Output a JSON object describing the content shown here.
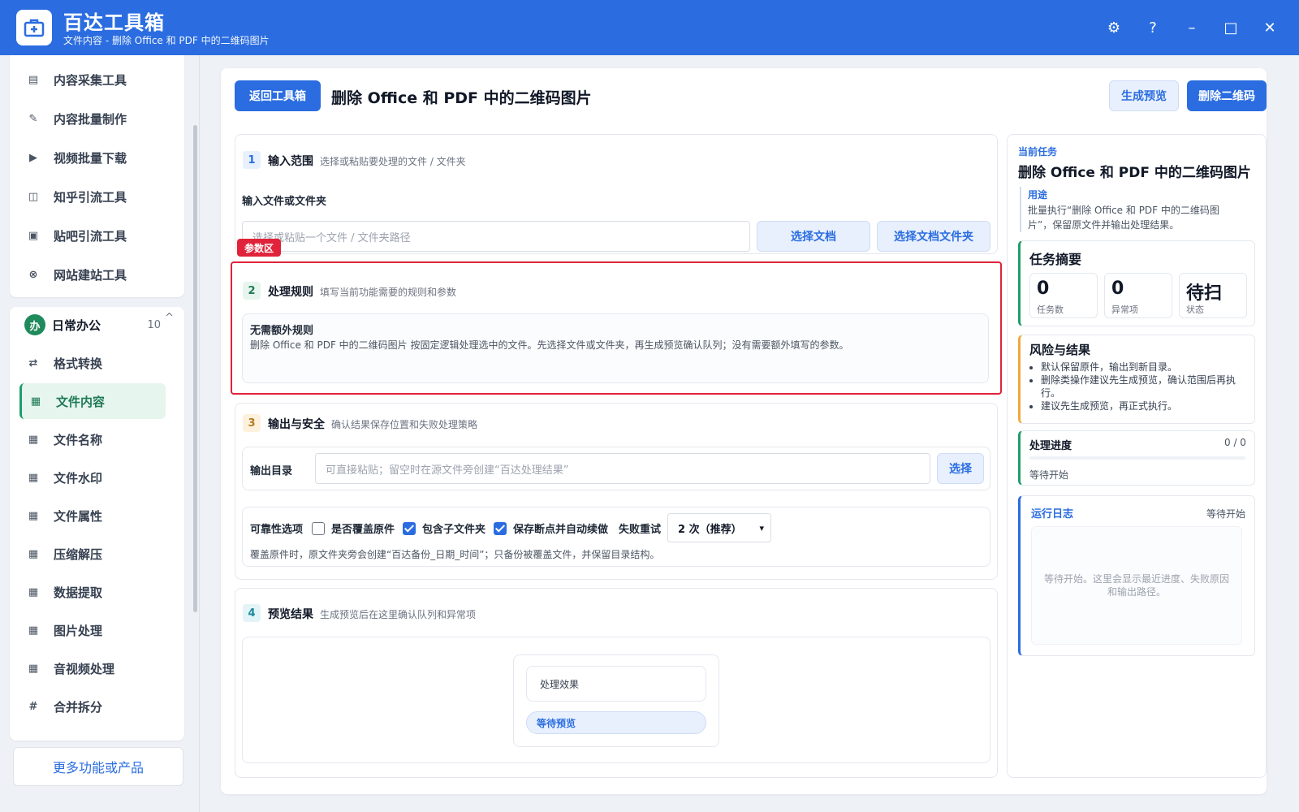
{
  "app": {
    "name": "百达工具箱",
    "subtitle": "文件内容 - 删除 Office 和 PDF 中的二维码图片",
    "controls": {
      "settings": "⚙",
      "help": "?",
      "minimize": "–",
      "maximize": "□",
      "close": "✕"
    }
  },
  "sidebar": {
    "top_items": [
      {
        "label": "内容采集工具",
        "icon": "collect-icon"
      },
      {
        "label": "内容批量制作",
        "icon": "pen-icon"
      },
      {
        "label": "视频批量下载",
        "icon": "video-icon"
      },
      {
        "label": "知乎引流工具",
        "icon": "zhihu-icon"
      },
      {
        "label": "贴吧引流工具",
        "icon": "tieba-icon"
      },
      {
        "label": "网站建站工具",
        "icon": "web-icon"
      }
    ],
    "group": {
      "badge": "办",
      "title": "日常办公",
      "count": "10",
      "toggle": "^"
    },
    "group_items": [
      {
        "label": "格式转换",
        "icon": "convert-icon",
        "glyph": "⇄"
      },
      {
        "label": "文件内容",
        "icon": "grid-icon",
        "glyph": "▦",
        "active": true
      },
      {
        "label": "文件名称",
        "icon": "grid-icon",
        "glyph": "▦"
      },
      {
        "label": "文件水印",
        "icon": "grid-icon",
        "glyph": "▦"
      },
      {
        "label": "文件属性",
        "icon": "grid-icon",
        "glyph": "▦"
      },
      {
        "label": "压缩解压",
        "icon": "grid-icon",
        "glyph": "▦"
      },
      {
        "label": "数据提取",
        "icon": "grid-icon",
        "glyph": "▦"
      },
      {
        "label": "图片处理",
        "icon": "grid-icon",
        "glyph": "▦"
      },
      {
        "label": "音视频处理",
        "icon": "grid-icon",
        "glyph": "▦"
      },
      {
        "label": "合并拆分",
        "icon": "hash-icon",
        "glyph": "#"
      }
    ],
    "more": "更多功能或产品"
  },
  "header": {
    "back": "返回工具箱",
    "title": "删除 Office 和 PDF 中的二维码图片",
    "preview": "生成预览",
    "run": "删除二维码"
  },
  "step1": {
    "num": "1",
    "title": "输入范围",
    "desc": "选择或粘贴要处理的文件 / 文件夹",
    "field_label": "输入文件或文件夹",
    "placeholder": "选择或粘贴一个文件 / 文件夹路径",
    "select_doc": "选择文档",
    "select_folder": "选择文档文件夹"
  },
  "highlight_tag": "参数区",
  "step2": {
    "num": "2",
    "title": "处理规则",
    "desc": "填写当前功能需要的规则和参数",
    "rule_title": "无需额外规则",
    "rule_desc": "删除 Office 和 PDF 中的二维码图片 按固定逻辑处理选中的文件。先选择文件或文件夹，再生成预览确认队列；没有需要额外填写的参数。"
  },
  "step3": {
    "num": "3",
    "title": "输出与安全",
    "desc": "确认结果保存位置和失败处理策略",
    "output_label": "输出目录",
    "output_placeholder": "可直接粘贴；留空时在源文件旁创建“百达处理结果”",
    "output_select": "选择",
    "reliability_label": "可靠性选项",
    "overwrite_label": "是否覆盖原件",
    "overwrite_checked": false,
    "subfolder_label": "包含子文件夹",
    "subfolder_checked": true,
    "resume_label": "保存断点并自动续做",
    "resume_checked": true,
    "retry_label": "失败重试",
    "retry_value": "2 次（推荐）",
    "note": "覆盖原件时，原文件夹旁会创建“百达备份_日期_时间”；只备份被覆盖文件，并保留目录结构。"
  },
  "step4": {
    "num": "4",
    "title": "预览结果",
    "desc": "生成预览后在这里确认队列和异常项",
    "effect_label": "处理效果",
    "status": "等待预览"
  },
  "right": {
    "current_label": "当前任务",
    "task_title": "删除 Office 和 PDF 中的二维码图片",
    "purpose_label": "用途",
    "purpose_text": "批量执行“删除 Office 和 PDF 中的二维码图片”，保留原文件并输出处理结果。",
    "summary_title": "任务摘要",
    "stats": [
      {
        "value": "0",
        "label": "任务数"
      },
      {
        "value": "0",
        "label": "异常项"
      },
      {
        "value": "待扫",
        "label": "状态"
      }
    ],
    "risk_title": "风险与结果",
    "risks": [
      "默认保留原件，输出到新目录。",
      "删除类操作建议先生成预览，确认范围后再执行。",
      "建议先生成预览，再正式执行。"
    ],
    "progress_title": "处理进度",
    "progress_value": "0 / 0",
    "progress_fraction": 0,
    "progress_status": "等待开始",
    "log_title": "运行日志",
    "log_status": "等待开始",
    "log_placeholder": "等待开始。这里会显示最近进度、失败原因和输出路径。"
  },
  "colors": {
    "brand": "#2b6de0",
    "accent_green": "#1f9e6a",
    "highlight_red": "#e0233a",
    "risk_orange": "#f0a93b"
  }
}
